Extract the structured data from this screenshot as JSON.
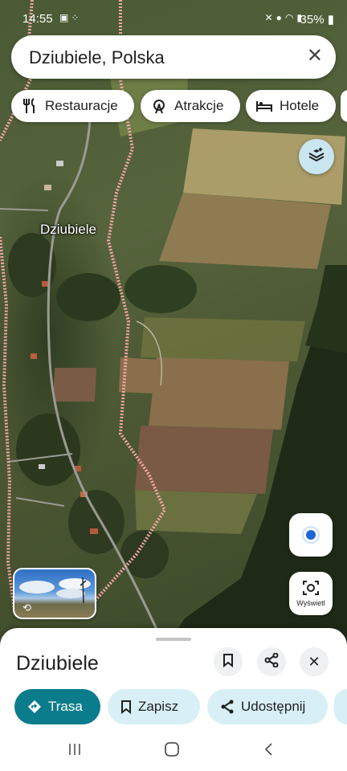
{
  "status_bar": {
    "time": "14:55",
    "left_icons": [
      "image-icon",
      "dots-icon"
    ],
    "right_icons": [
      "mute-icon",
      "location-icon",
      "wifi-icon",
      "signal-icon"
    ],
    "battery": "35%"
  },
  "search": {
    "query": "Dziubiele, Polska"
  },
  "chips": [
    {
      "label": "Restauracje",
      "icon": "restaurant-icon"
    },
    {
      "label": "Atrakcje",
      "icon": "attractions-icon"
    },
    {
      "label": "Hotele",
      "icon": "hotel-icon"
    }
  ],
  "map": {
    "place_label": "Dziubiele",
    "lens_label": "Wyświetl",
    "boundary_color": "#f3a6a6",
    "road_color": "#9a9a92"
  },
  "sheet": {
    "title": "Dziubiele",
    "actions": [
      {
        "label": "Trasa",
        "icon": "directions-icon",
        "style": "primary"
      },
      {
        "label": "Zapisz",
        "icon": "bookmark-icon",
        "style": "secondary"
      },
      {
        "label": "Udostępnij",
        "icon": "share-icon",
        "style": "secondary"
      }
    ]
  },
  "colors": {
    "primary_teal": "#0b7c8c",
    "secondary_chip": "#d8f0f5",
    "layers_bg": "#c9e6f0",
    "locate_dot": "#1a66d9"
  }
}
